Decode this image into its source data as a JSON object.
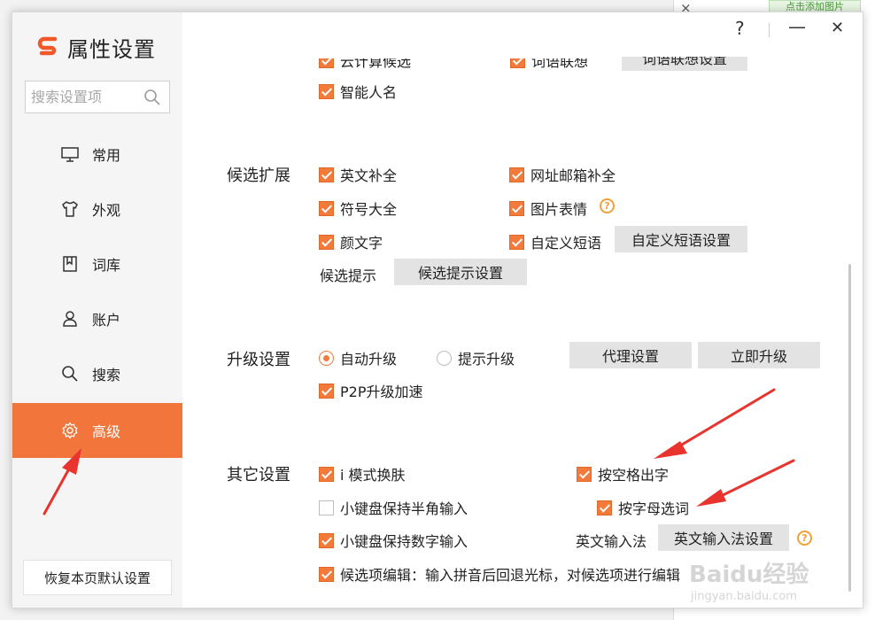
{
  "window": {
    "title": "属性设置",
    "controls": {
      "help": "?",
      "minimize": "—",
      "close": "✕"
    }
  },
  "background": {
    "close_glyph": "×",
    "link_text": "点击添加图片"
  },
  "search": {
    "placeholder": "搜索设置项"
  },
  "sidebar": {
    "items": [
      {
        "label": "常用",
        "icon": "monitor-icon"
      },
      {
        "label": "外观",
        "icon": "shirt-icon"
      },
      {
        "label": "词库",
        "icon": "bookmark-icon"
      },
      {
        "label": "账户",
        "icon": "user-icon"
      },
      {
        "label": "搜索",
        "icon": "search-icon"
      },
      {
        "label": "高级",
        "icon": "gear-icon",
        "active": true
      }
    ],
    "restore_label": "恢复本页默认设置"
  },
  "top_partial": {
    "cloud": "云计算候选",
    "assoc": "词语联想",
    "assoc_btn": "词语联想设置",
    "smart_name": "智能人名"
  },
  "candidate_ext": {
    "label": "候选扩展",
    "english_complete": "英文补全",
    "url_email_complete": "网址邮箱补全",
    "symbols": "符号大全",
    "image_emoji": "图片表情",
    "kaomoji": "颜文字",
    "custom_phrase": "自定义短语",
    "custom_phrase_btn": "自定义短语设置",
    "hint_label": "候选提示",
    "hint_btn": "候选提示设置"
  },
  "upgrade": {
    "label": "升级设置",
    "auto": "自动升级",
    "prompt": "提示升级",
    "proxy_btn": "代理设置",
    "now_btn": "立即升级",
    "p2p": "P2P升级加速"
  },
  "other": {
    "label": "其它设置",
    "i_mode": "i 模式换肤",
    "space_output": "按空格出字",
    "keypad_half": "小键盘保持半角输入",
    "letter_select": "按字母选词",
    "keypad_digit": "小键盘保持数字输入",
    "english_ime_label": "英文输入法",
    "english_ime_btn": "英文输入法设置",
    "candidate_edit": "候选项编辑：输入拼音后回退光标，对候选项进行编辑"
  },
  "watermark": {
    "brand": "Baidu经验",
    "url": "jingyan.baidu.com"
  },
  "colors": {
    "accent": "#f2763c",
    "annotation_arrow": "#e8332e"
  }
}
